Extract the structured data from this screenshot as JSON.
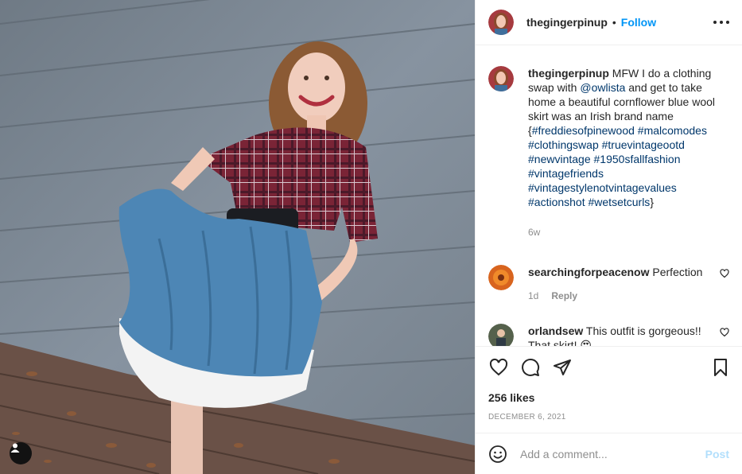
{
  "post": {
    "author": "thegingerpinup",
    "follow_label": "Follow",
    "separator": "•",
    "caption": {
      "parts": [
        {
          "type": "text",
          "value": "MFW I do a clothing swap with "
        },
        {
          "type": "link",
          "value": "@owlista"
        },
        {
          "type": "text",
          "value": " and get to take home a beautiful cornflower blue wool skirt was an Irish brand name {"
        },
        {
          "type": "link",
          "value": "#freddiesofpinewood"
        },
        {
          "type": "text",
          "value": " "
        },
        {
          "type": "link",
          "value": "#malcomodes"
        },
        {
          "type": "text",
          "value": " "
        },
        {
          "type": "link",
          "value": "#clothingswap"
        },
        {
          "type": "text",
          "value": " "
        },
        {
          "type": "link",
          "value": "#truevintageootd"
        },
        {
          "type": "text",
          "value": " "
        },
        {
          "type": "link",
          "value": "#newvintage"
        },
        {
          "type": "text",
          "value": " "
        },
        {
          "type": "link",
          "value": "#1950sfallfashion"
        },
        {
          "type": "text",
          "value": " "
        },
        {
          "type": "link",
          "value": "#vintagefriends"
        },
        {
          "type": "text",
          "value": " "
        },
        {
          "type": "link",
          "value": "#vintagestylenotvintagevalues"
        },
        {
          "type": "text",
          "value": " "
        },
        {
          "type": "link",
          "value": "#actionshot"
        },
        {
          "type": "text",
          "value": " "
        },
        {
          "type": "link",
          "value": "#wetsetcurls"
        },
        {
          "type": "text",
          "value": "}"
        }
      ],
      "age": "6w"
    },
    "comments": [
      {
        "user": "searchingforpeacenow",
        "text": "Perfection",
        "age": "1d",
        "reply_label": "Reply"
      },
      {
        "user": "orlandsew",
        "text": "This outfit is gorgeous!! That skirt! 😍"
      }
    ],
    "likes": "256 likes",
    "date": "DECEMBER 6, 2021",
    "comment_box": {
      "placeholder": "Add a comment...",
      "post_label": "Post"
    }
  },
  "icons": {
    "more": "more-options-icon",
    "heart": "heart-icon",
    "comment": "comment-icon",
    "share": "share-icon",
    "save": "bookmark-icon",
    "emoji": "emoji-icon",
    "tag": "user-tag-icon"
  },
  "colors": {
    "accent": "#0095f6",
    "link": "#00376b",
    "muted": "#8e8e8e",
    "post_disabled": "#b2dffc"
  }
}
